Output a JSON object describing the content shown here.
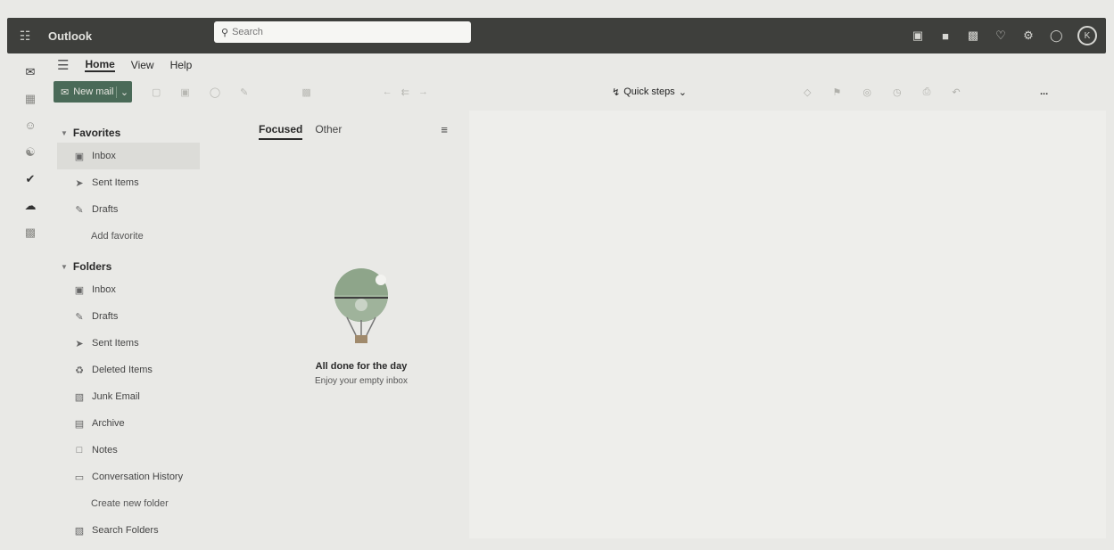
{
  "app": {
    "title": "Outlook"
  },
  "search": {
    "placeholder": "Search"
  },
  "topbar_icons": [
    "meet-now-icon",
    "word-icon",
    "teams-icon",
    "bell-icon",
    "gear-icon",
    "lightbulb-icon"
  ],
  "account": {
    "initial": "K"
  },
  "rail": [
    "mail-icon",
    "calendar-icon",
    "people-icon",
    "groups-icon",
    "todo-icon",
    "onedrive-icon",
    "apps-icon"
  ],
  "ribbon": {
    "tabs": [
      "Home",
      "View",
      "Help"
    ],
    "active_tab": "Home",
    "new_mail": "New mail",
    "quick_steps": "Quick steps",
    "more": "..."
  },
  "favorites": {
    "title": "Favorites",
    "items": [
      {
        "label": "Inbox",
        "icon": "inbox-icon",
        "selected": true
      },
      {
        "label": "Sent Items",
        "icon": "send-icon"
      },
      {
        "label": "Drafts",
        "icon": "pencil-icon"
      }
    ],
    "add": "Add favorite"
  },
  "folders": {
    "title": "Folders",
    "items": [
      {
        "label": "Inbox",
        "icon": "inbox-icon"
      },
      {
        "label": "Drafts",
        "icon": "pencil-icon"
      },
      {
        "label": "Sent Items",
        "icon": "send-icon"
      },
      {
        "label": "Deleted Items",
        "icon": "trash-icon"
      },
      {
        "label": "Junk Email",
        "icon": "junk-icon"
      },
      {
        "label": "Archive",
        "icon": "archive-icon"
      },
      {
        "label": "Notes",
        "icon": "note-icon"
      },
      {
        "label": "Conversation History",
        "icon": "folder-icon"
      }
    ],
    "create": "Create new folder",
    "search_folders": "Search Folders"
  },
  "message_list": {
    "tabs": [
      "Focused",
      "Other"
    ],
    "active_tab": "Focused",
    "empty_title": "All done for the day",
    "empty_subtitle": "Enjoy your empty inbox"
  }
}
